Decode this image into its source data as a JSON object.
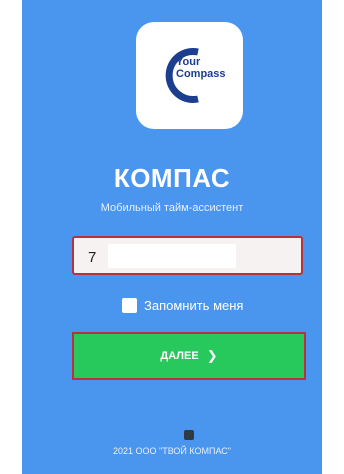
{
  "app": {
    "logo_text_line1": "Your",
    "logo_text_line2": "Compass",
    "title": "КОМПАС",
    "subtitle": "Мобильный тайм-ассистент"
  },
  "form": {
    "phone_value": "7",
    "remember_label": "Запомнить меня",
    "remember_checked": false,
    "next_label": "ДАЛЕЕ",
    "next_icon": "chevron-right-icon"
  },
  "footer": {
    "text": "2021 ООО \"ТВОЙ КОМПАС\""
  },
  "colors": {
    "background": "#4a95ee",
    "button": "#27c95c",
    "error_border": "#b7323c",
    "logo_text": "#1c3e8e"
  }
}
